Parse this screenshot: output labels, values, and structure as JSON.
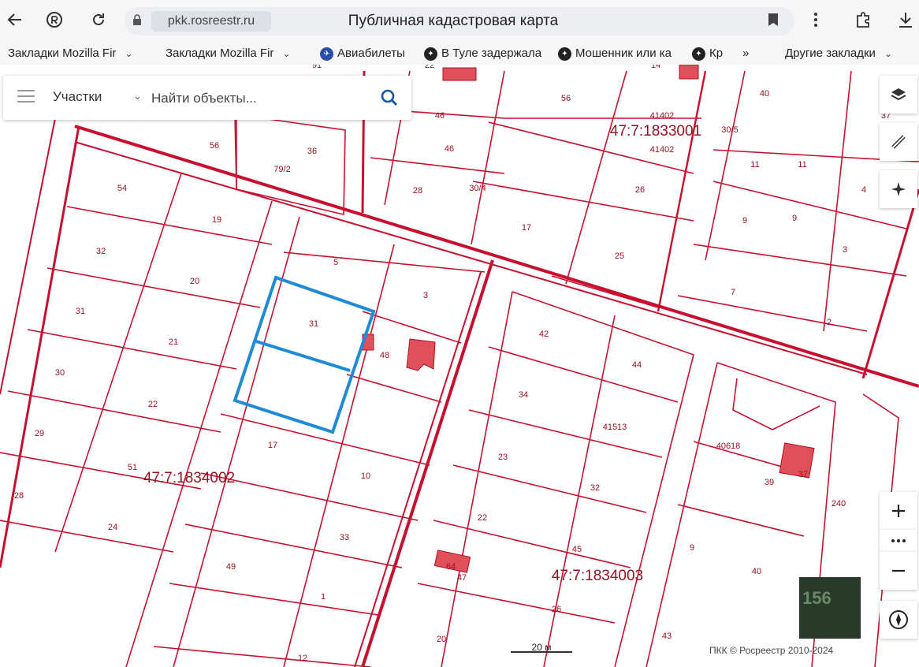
{
  "browser": {
    "url": "pkk.rosreestr.ru",
    "page_title": "Публичная кадастровая карта",
    "bookmarks": [
      {
        "label": "Закладки Mozilla Fir",
        "has_chevron": true
      },
      {
        "label": "Закладки Mozilla Fir",
        "has_chevron": true
      },
      {
        "label": "Авиабилеты",
        "icon": "avia-icon"
      },
      {
        "label": "В Туле задержала",
        "icon": "news-icon"
      },
      {
        "label": "Мошенник или ка",
        "icon": "news-icon"
      },
      {
        "label": "Кр",
        "icon": "news-icon"
      },
      {
        "label": "»"
      },
      {
        "label": "Другие закладки",
        "has_chevron": true
      }
    ]
  },
  "search_panel": {
    "layer_select": "Участки",
    "placeholder": "Найти объекты..."
  },
  "map": {
    "block_labels": [
      {
        "text": "47:7:1833001"
      },
      {
        "text": "47:7:1834002"
      },
      {
        "text": "47:7:1834003"
      }
    ],
    "plot_numbers": [
      "22",
      "14",
      "91",
      "40",
      "37",
      "46",
      "56",
      "41402",
      "46",
      "41402",
      "56",
      "36",
      "79/2",
      "28",
      "30/4",
      "26",
      "30/5",
      "11",
      "11",
      "4",
      "54",
      "19",
      "17",
      "9",
      "9",
      "32",
      "5",
      "25",
      "3",
      "20",
      "3",
      "7",
      "31",
      "31",
      "21",
      "42",
      "2",
      "48",
      "44",
      "30",
      "22",
      "34",
      "41513",
      "40618",
      "29",
      "51",
      "17",
      "10",
      "23",
      "32",
      "39",
      "37",
      "28",
      "240",
      "22",
      "24",
      "33",
      "45",
      "9",
      "40",
      "49",
      "64",
      "47",
      "1",
      "26",
      "20",
      "43",
      "12"
    ],
    "scale_label": "20 м",
    "copyright": "ПКК © Росреестр 2010-2024",
    "minimap_label": "156"
  },
  "colors": {
    "parcel_border": "#c8102e",
    "parcel_label": "#9b1020",
    "selected_parcel": "#1f8ad6",
    "building_fill": "#e0505a"
  }
}
